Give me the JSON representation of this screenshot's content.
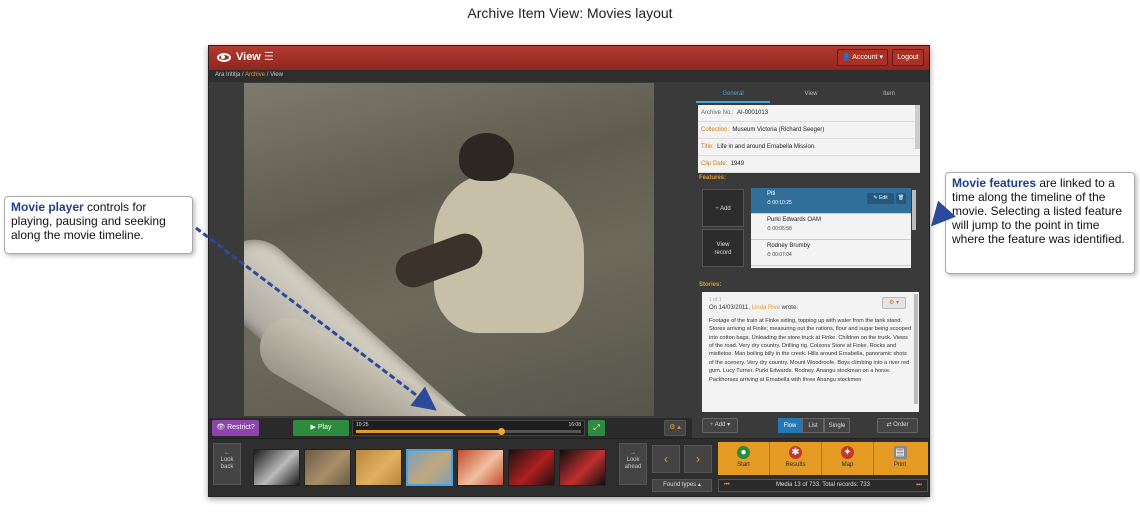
{
  "page": {
    "heading": "Archive Item View: Movies layout"
  },
  "topbar": {
    "title": "View",
    "account_label": "Account",
    "logout_label": "Logout"
  },
  "breadcrumb": {
    "root": "Ara Irititja",
    "sep1": "/",
    "archive": "Archive",
    "sep2": "/",
    "current": "View"
  },
  "player": {
    "restrict_label": "Restrict?",
    "play_label": "Play",
    "time_start": "10:25",
    "time_end": "16:08",
    "progress_fraction": 0.646
  },
  "panel": {
    "tabs": [
      {
        "label": "General",
        "active": true
      },
      {
        "label": "View",
        "active": false
      },
      {
        "label": "Item",
        "active": false
      }
    ],
    "info": [
      {
        "key": "Archive No.:",
        "value": "AI-0001013"
      },
      {
        "key": "Collection:",
        "value": "Museum Victoria (Richard Seeger)"
      },
      {
        "key": "Title:",
        "value": "Life in and around Ernabella Mission."
      },
      {
        "key": "Clip Date:",
        "value": "1949"
      }
    ],
    "features_label": "Features:",
    "add_feature_label": "Add",
    "view_record_line1": "View",
    "view_record_line2": "record",
    "features": [
      {
        "name": "Piti",
        "time": "00:10:25",
        "selected": true
      },
      {
        "name": "Purki Edwards OAM",
        "time": "00:06:58",
        "selected": false
      },
      {
        "name": "Rodney Brumby",
        "time": "00:07:04",
        "selected": false
      }
    ],
    "edit_label": "Edit",
    "stories_label": "Stories:",
    "story": {
      "number": "1 of 1",
      "date_prefix": "On 14/03/2011,",
      "author": "Linda Rive",
      "suffix": "wrote:",
      "text": "Footage of the train at Finke siding, topping up with water from the tank stand. Stores arriving at Finke; measuring out the rations, flour and sugar being scooped into cotton bags. Unloading the store truck at Finke. Children on the truck. Views of the road. Very dry country. Drilling rig. Colsons Store at Finke. Rocks and mistletoe. Man boiling billy in the creek. Hills around Ernabella, panoramic shots of the scenery. Very dry country. Mount Woodroofe. Boys climbing into a river red gum. Lucy Turner. Purki Edwards. Rodney. Anangu stockman on a horse. Packhorses arriving at Ernabella with three Anangu stockmen"
    },
    "story_add_label": "Add",
    "view_modes": [
      {
        "label": "Flow",
        "active": true
      },
      {
        "label": "List",
        "active": false
      },
      {
        "label": "Single",
        "active": false
      }
    ],
    "order_label": "Order"
  },
  "bottom": {
    "look_back_line1": "Look",
    "look_back_line2": "back",
    "look_ahead_line1": "Look",
    "look_ahead_line2": "ahead",
    "thumbnails": [
      {
        "color": "#1a1a1a",
        "accent": "#bbbbbb",
        "active": false
      },
      {
        "color": "#6b5a45",
        "accent": "#a89068",
        "active": false
      },
      {
        "color": "#b7853d",
        "accent": "#e0b060",
        "active": false
      },
      {
        "color": "#7fa0b8",
        "accent": "#c2a77c",
        "active": true
      },
      {
        "color": "#c14a2e",
        "accent": "#f0c0a0",
        "active": false
      },
      {
        "color": "#1c1010",
        "accent": "#b02020",
        "active": false
      },
      {
        "color": "#0d0d0d",
        "accent": "#c03030",
        "active": false
      }
    ],
    "found_types_label": "Found types",
    "actions": [
      {
        "label": "Start",
        "icon": "start-icon",
        "color": "#2e8b3d"
      },
      {
        "label": "Results",
        "icon": "results-icon",
        "color": "#c0392b"
      },
      {
        "label": "Map",
        "icon": "map-icon",
        "color": "#c0392b"
      },
      {
        "label": "Print",
        "icon": "print-icon",
        "color": "#888888"
      }
    ],
    "pager_text": "Media 13 of 733. Total records: 733"
  },
  "callouts": {
    "left": {
      "lead": "Movie player",
      "text": " controls for playing, pausing and seeking along the movie timeline."
    },
    "right": {
      "lead": "Movie features",
      "text": " are linked to a time along the timeline of the movie.  Selecting a listed feature will jump to the point in time where the feature was identified."
    }
  }
}
